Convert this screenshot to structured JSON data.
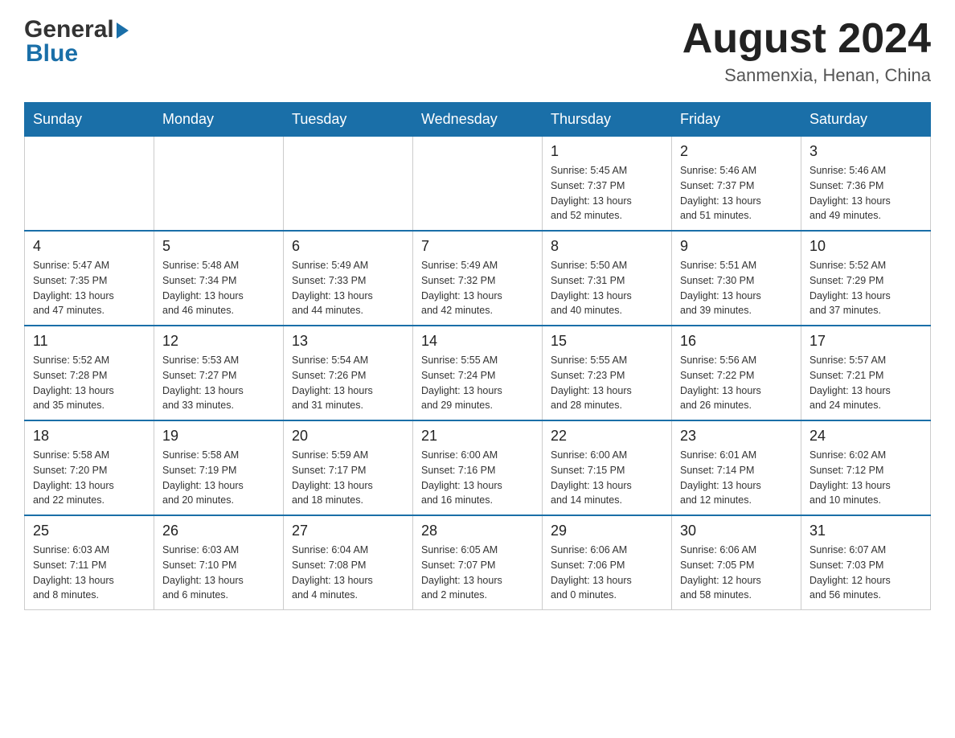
{
  "header": {
    "logo_general": "General",
    "logo_blue": "Blue",
    "month_title": "August 2024",
    "location": "Sanmenxia, Henan, China"
  },
  "calendar": {
    "days_of_week": [
      "Sunday",
      "Monday",
      "Tuesday",
      "Wednesday",
      "Thursday",
      "Friday",
      "Saturday"
    ],
    "weeks": [
      [
        {
          "day": "",
          "info": ""
        },
        {
          "day": "",
          "info": ""
        },
        {
          "day": "",
          "info": ""
        },
        {
          "day": "",
          "info": ""
        },
        {
          "day": "1",
          "info": "Sunrise: 5:45 AM\nSunset: 7:37 PM\nDaylight: 13 hours\nand 52 minutes."
        },
        {
          "day": "2",
          "info": "Sunrise: 5:46 AM\nSunset: 7:37 PM\nDaylight: 13 hours\nand 51 minutes."
        },
        {
          "day": "3",
          "info": "Sunrise: 5:46 AM\nSunset: 7:36 PM\nDaylight: 13 hours\nand 49 minutes."
        }
      ],
      [
        {
          "day": "4",
          "info": "Sunrise: 5:47 AM\nSunset: 7:35 PM\nDaylight: 13 hours\nand 47 minutes."
        },
        {
          "day": "5",
          "info": "Sunrise: 5:48 AM\nSunset: 7:34 PM\nDaylight: 13 hours\nand 46 minutes."
        },
        {
          "day": "6",
          "info": "Sunrise: 5:49 AM\nSunset: 7:33 PM\nDaylight: 13 hours\nand 44 minutes."
        },
        {
          "day": "7",
          "info": "Sunrise: 5:49 AM\nSunset: 7:32 PM\nDaylight: 13 hours\nand 42 minutes."
        },
        {
          "day": "8",
          "info": "Sunrise: 5:50 AM\nSunset: 7:31 PM\nDaylight: 13 hours\nand 40 minutes."
        },
        {
          "day": "9",
          "info": "Sunrise: 5:51 AM\nSunset: 7:30 PM\nDaylight: 13 hours\nand 39 minutes."
        },
        {
          "day": "10",
          "info": "Sunrise: 5:52 AM\nSunset: 7:29 PM\nDaylight: 13 hours\nand 37 minutes."
        }
      ],
      [
        {
          "day": "11",
          "info": "Sunrise: 5:52 AM\nSunset: 7:28 PM\nDaylight: 13 hours\nand 35 minutes."
        },
        {
          "day": "12",
          "info": "Sunrise: 5:53 AM\nSunset: 7:27 PM\nDaylight: 13 hours\nand 33 minutes."
        },
        {
          "day": "13",
          "info": "Sunrise: 5:54 AM\nSunset: 7:26 PM\nDaylight: 13 hours\nand 31 minutes."
        },
        {
          "day": "14",
          "info": "Sunrise: 5:55 AM\nSunset: 7:24 PM\nDaylight: 13 hours\nand 29 minutes."
        },
        {
          "day": "15",
          "info": "Sunrise: 5:55 AM\nSunset: 7:23 PM\nDaylight: 13 hours\nand 28 minutes."
        },
        {
          "day": "16",
          "info": "Sunrise: 5:56 AM\nSunset: 7:22 PM\nDaylight: 13 hours\nand 26 minutes."
        },
        {
          "day": "17",
          "info": "Sunrise: 5:57 AM\nSunset: 7:21 PM\nDaylight: 13 hours\nand 24 minutes."
        }
      ],
      [
        {
          "day": "18",
          "info": "Sunrise: 5:58 AM\nSunset: 7:20 PM\nDaylight: 13 hours\nand 22 minutes."
        },
        {
          "day": "19",
          "info": "Sunrise: 5:58 AM\nSunset: 7:19 PM\nDaylight: 13 hours\nand 20 minutes."
        },
        {
          "day": "20",
          "info": "Sunrise: 5:59 AM\nSunset: 7:17 PM\nDaylight: 13 hours\nand 18 minutes."
        },
        {
          "day": "21",
          "info": "Sunrise: 6:00 AM\nSunset: 7:16 PM\nDaylight: 13 hours\nand 16 minutes."
        },
        {
          "day": "22",
          "info": "Sunrise: 6:00 AM\nSunset: 7:15 PM\nDaylight: 13 hours\nand 14 minutes."
        },
        {
          "day": "23",
          "info": "Sunrise: 6:01 AM\nSunset: 7:14 PM\nDaylight: 13 hours\nand 12 minutes."
        },
        {
          "day": "24",
          "info": "Sunrise: 6:02 AM\nSunset: 7:12 PM\nDaylight: 13 hours\nand 10 minutes."
        }
      ],
      [
        {
          "day": "25",
          "info": "Sunrise: 6:03 AM\nSunset: 7:11 PM\nDaylight: 13 hours\nand 8 minutes."
        },
        {
          "day": "26",
          "info": "Sunrise: 6:03 AM\nSunset: 7:10 PM\nDaylight: 13 hours\nand 6 minutes."
        },
        {
          "day": "27",
          "info": "Sunrise: 6:04 AM\nSunset: 7:08 PM\nDaylight: 13 hours\nand 4 minutes."
        },
        {
          "day": "28",
          "info": "Sunrise: 6:05 AM\nSunset: 7:07 PM\nDaylight: 13 hours\nand 2 minutes."
        },
        {
          "day": "29",
          "info": "Sunrise: 6:06 AM\nSunset: 7:06 PM\nDaylight: 13 hours\nand 0 minutes."
        },
        {
          "day": "30",
          "info": "Sunrise: 6:06 AM\nSunset: 7:05 PM\nDaylight: 12 hours\nand 58 minutes."
        },
        {
          "day": "31",
          "info": "Sunrise: 6:07 AM\nSunset: 7:03 PM\nDaylight: 12 hours\nand 56 minutes."
        }
      ]
    ]
  }
}
